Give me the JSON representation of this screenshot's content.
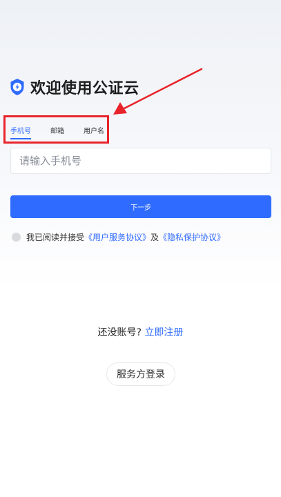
{
  "brand": {
    "title": "欢迎使用公证云",
    "logo_icon": "shield-lightning-icon",
    "accent_color": "#2f6bff"
  },
  "tabs": [
    {
      "label": "手机号",
      "active": true
    },
    {
      "label": "邮箱",
      "active": false
    },
    {
      "label": "用户名",
      "active": false
    }
  ],
  "phone_input": {
    "placeholder": "请输入手机号",
    "value": ""
  },
  "next_button": {
    "label": "下一步"
  },
  "agreement": {
    "prefix": "我已阅读并接受",
    "service_link": "《用户服务协议》",
    "joiner": "及",
    "privacy_link": "《隐私保护协议》",
    "checked": false
  },
  "register": {
    "prompt": "还没账号?",
    "link": "立即注册"
  },
  "provider_login": {
    "label": "服务方登录"
  },
  "annotation_color": "#e8232a"
}
